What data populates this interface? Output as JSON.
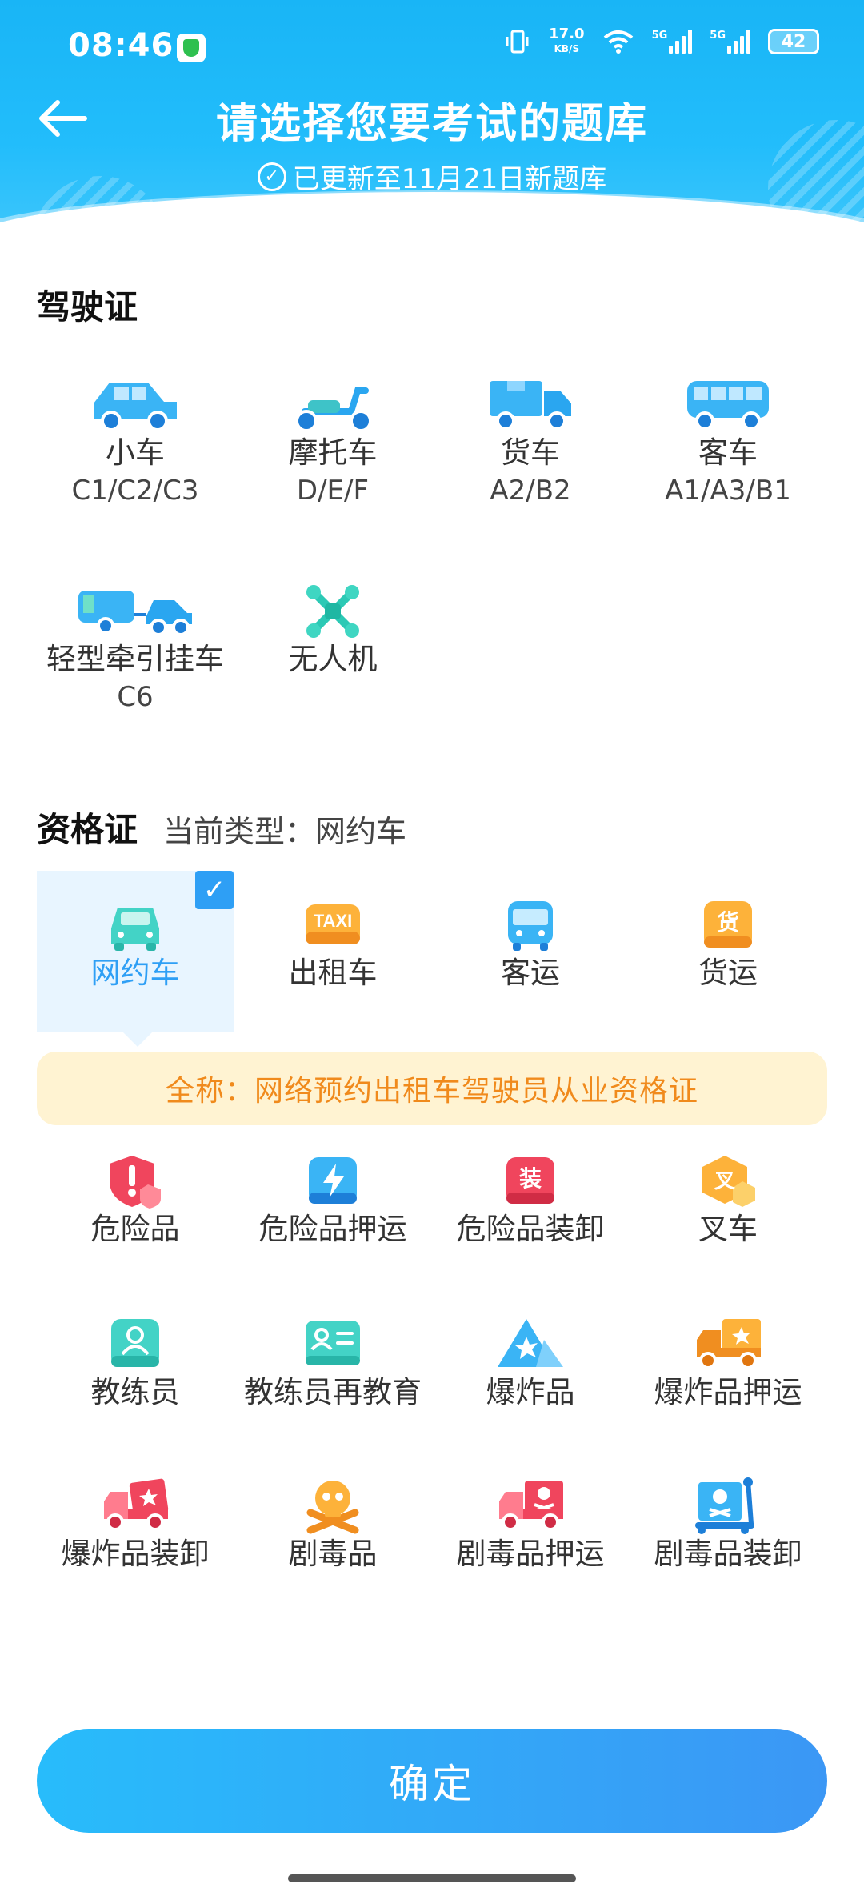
{
  "status_bar": {
    "time": "08:46",
    "speed_value": "17.0",
    "speed_unit": "KB/S",
    "net1": "5G",
    "net2": "5G",
    "battery": "42"
  },
  "header": {
    "title": "请选择您要考试的题库",
    "subtitle": "已更新至11月21日新题库"
  },
  "driving": {
    "title": "驾驶证",
    "items": [
      {
        "label": "小车",
        "sub": "C1/C2/C3",
        "icon": "car-icon"
      },
      {
        "label": "摩托车",
        "sub": "D/E/F",
        "icon": "motorcycle-icon"
      },
      {
        "label": "货车",
        "sub": "A2/B2",
        "icon": "truck-icon"
      },
      {
        "label": "客车",
        "sub": "A1/A3/B1",
        "icon": "bus-icon"
      },
      {
        "label": "轻型牵引挂车",
        "sub": "C6",
        "icon": "trailer-icon"
      },
      {
        "label": "无人机",
        "sub": "",
        "icon": "drone-icon"
      }
    ]
  },
  "qualification": {
    "title": "资格证",
    "current_label": "当前类型：网约车",
    "items": [
      {
        "label": "网约车",
        "icon": "ride-hailing-icon"
      },
      {
        "label": "出租车",
        "icon": "taxi-icon"
      },
      {
        "label": "客运",
        "icon": "passenger-transport-icon"
      },
      {
        "label": "货运",
        "icon": "freight-icon"
      },
      {
        "label": "危险品",
        "icon": "danger-goods-icon"
      },
      {
        "label": "危险品押运",
        "icon": "danger-escort-icon"
      },
      {
        "label": "危险品装卸",
        "icon": "danger-loading-icon"
      },
      {
        "label": "叉车",
        "icon": "forklift-icon"
      },
      {
        "label": "教练员",
        "icon": "coach-icon"
      },
      {
        "label": "教练员再教育",
        "icon": "coach-reeducation-icon"
      },
      {
        "label": "爆炸品",
        "icon": "explosive-icon"
      },
      {
        "label": "爆炸品押运",
        "icon": "explosive-escort-icon"
      },
      {
        "label": "爆炸品装卸",
        "icon": "explosive-loading-icon"
      },
      {
        "label": "剧毒品",
        "icon": "toxic-icon"
      },
      {
        "label": "剧毒品押运",
        "icon": "toxic-escort-icon"
      },
      {
        "label": "剧毒品装卸",
        "icon": "toxic-loading-icon"
      }
    ],
    "selected_index": 0,
    "full_name": "全称：网络预约出租车驾驶员从业资格证",
    "taxi_text": "TAXI",
    "freight_char": "货",
    "loading_char": "装",
    "forklift_char": "叉"
  },
  "confirm_label": "确定",
  "colors": {
    "primary": "#21b8fa",
    "selected_bg": "#e8f5ff",
    "note_bg": "#fff3d2",
    "note_text": "#f08a1c"
  }
}
